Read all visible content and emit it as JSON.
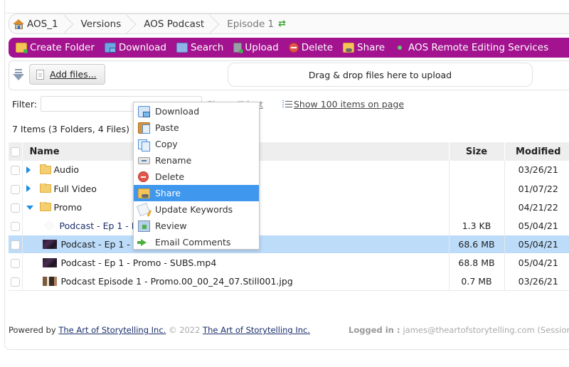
{
  "breadcrumb": {
    "items": [
      {
        "label": "AOS_1",
        "icon": "home-icon"
      },
      {
        "label": "Versions"
      },
      {
        "label": "AOS Podcast"
      },
      {
        "label": "Episode 1",
        "icon": "refresh-icon",
        "current": true
      }
    ],
    "refresh_glyph": "⇄"
  },
  "toolbar": {
    "background": "#a3128f",
    "items": [
      {
        "label": "Create Folder",
        "icon": "create-folder-icon"
      },
      {
        "label": "Download",
        "icon": "download-icon"
      },
      {
        "label": "Search",
        "icon": "search-icon"
      },
      {
        "label": "Upload",
        "icon": "upload-icon"
      },
      {
        "label": "Delete",
        "icon": "delete-icon"
      },
      {
        "label": "Share",
        "icon": "share-icon"
      },
      {
        "label": "AOS Remote Editing Services",
        "icon": "status-dot-icon"
      }
    ]
  },
  "upload": {
    "add_files_label": "Add files...",
    "dropzone_text": "Drag & drop files here to upload"
  },
  "filter": {
    "label": "Filter:",
    "value": "",
    "clear_label": "Cl",
    "select_label": "Select",
    "select_visible": "lect",
    "show_items_label": "Show 100 items on page"
  },
  "summary": "7 Items (3 Folders, 4 Files)",
  "table": {
    "columns": [
      "Name",
      "Size",
      "Modified"
    ],
    "rows": [
      {
        "type": "folder",
        "name": "Audio",
        "size": "",
        "modified": "03/26/21",
        "expanded": false
      },
      {
        "type": "folder",
        "name": "Full Video",
        "size": "",
        "modified": "01/07/22",
        "expanded": false
      },
      {
        "type": "folder",
        "name": "Promo",
        "size": "",
        "modified": "04/21/22",
        "expanded": true
      },
      {
        "type": "file",
        "thumb": "blank",
        "name": "Podcast - Ep 1 - Pro",
        "size": "1.3 KB",
        "modified": "05/04/21",
        "link": true
      },
      {
        "type": "file",
        "thumb": "video",
        "name": "Podcast - Ep 1 - Pro",
        "size": "68.6 MB",
        "modified": "05/04/21",
        "selected": true
      },
      {
        "type": "file",
        "thumb": "video",
        "name": "Podcast - Ep 1 - Promo - SUBS.mp4",
        "size": "68.8 MB",
        "modified": "05/04/21"
      },
      {
        "type": "file",
        "thumb": "photo",
        "name": "Podcast Episode 1 - Promo.00_00_24_07.Still001.jpg",
        "size": "0.7 MB",
        "modified": "03/26/21"
      }
    ]
  },
  "context_menu": {
    "items": [
      {
        "label": "Download",
        "icon": "download-icon"
      },
      {
        "label": "Paste",
        "icon": "paste-icon"
      },
      {
        "label": "Copy",
        "icon": "copy-icon"
      },
      {
        "label": "Rename",
        "icon": "rename-icon"
      },
      {
        "label": "Delete",
        "icon": "delete-icon"
      },
      {
        "label": "Share",
        "icon": "share-icon",
        "active": true
      },
      {
        "label": "Update Keywords",
        "icon": "keywords-icon"
      },
      {
        "label": "Review",
        "icon": "review-icon"
      },
      {
        "label": "Email Comments",
        "icon": "email-arrow-icon"
      }
    ],
    "highlight_color": "#3f97ee"
  },
  "footer": {
    "powered_by": "Powered by ",
    "company_link": "The Art of Storytelling Inc.",
    "copyright": " © 2022 ",
    "company_link_2": "The Art of Storytelling Inc.",
    "logged_in_label": "Logged in : ",
    "logged_in_user": "james@theartofstorytelling.com (Session"
  }
}
